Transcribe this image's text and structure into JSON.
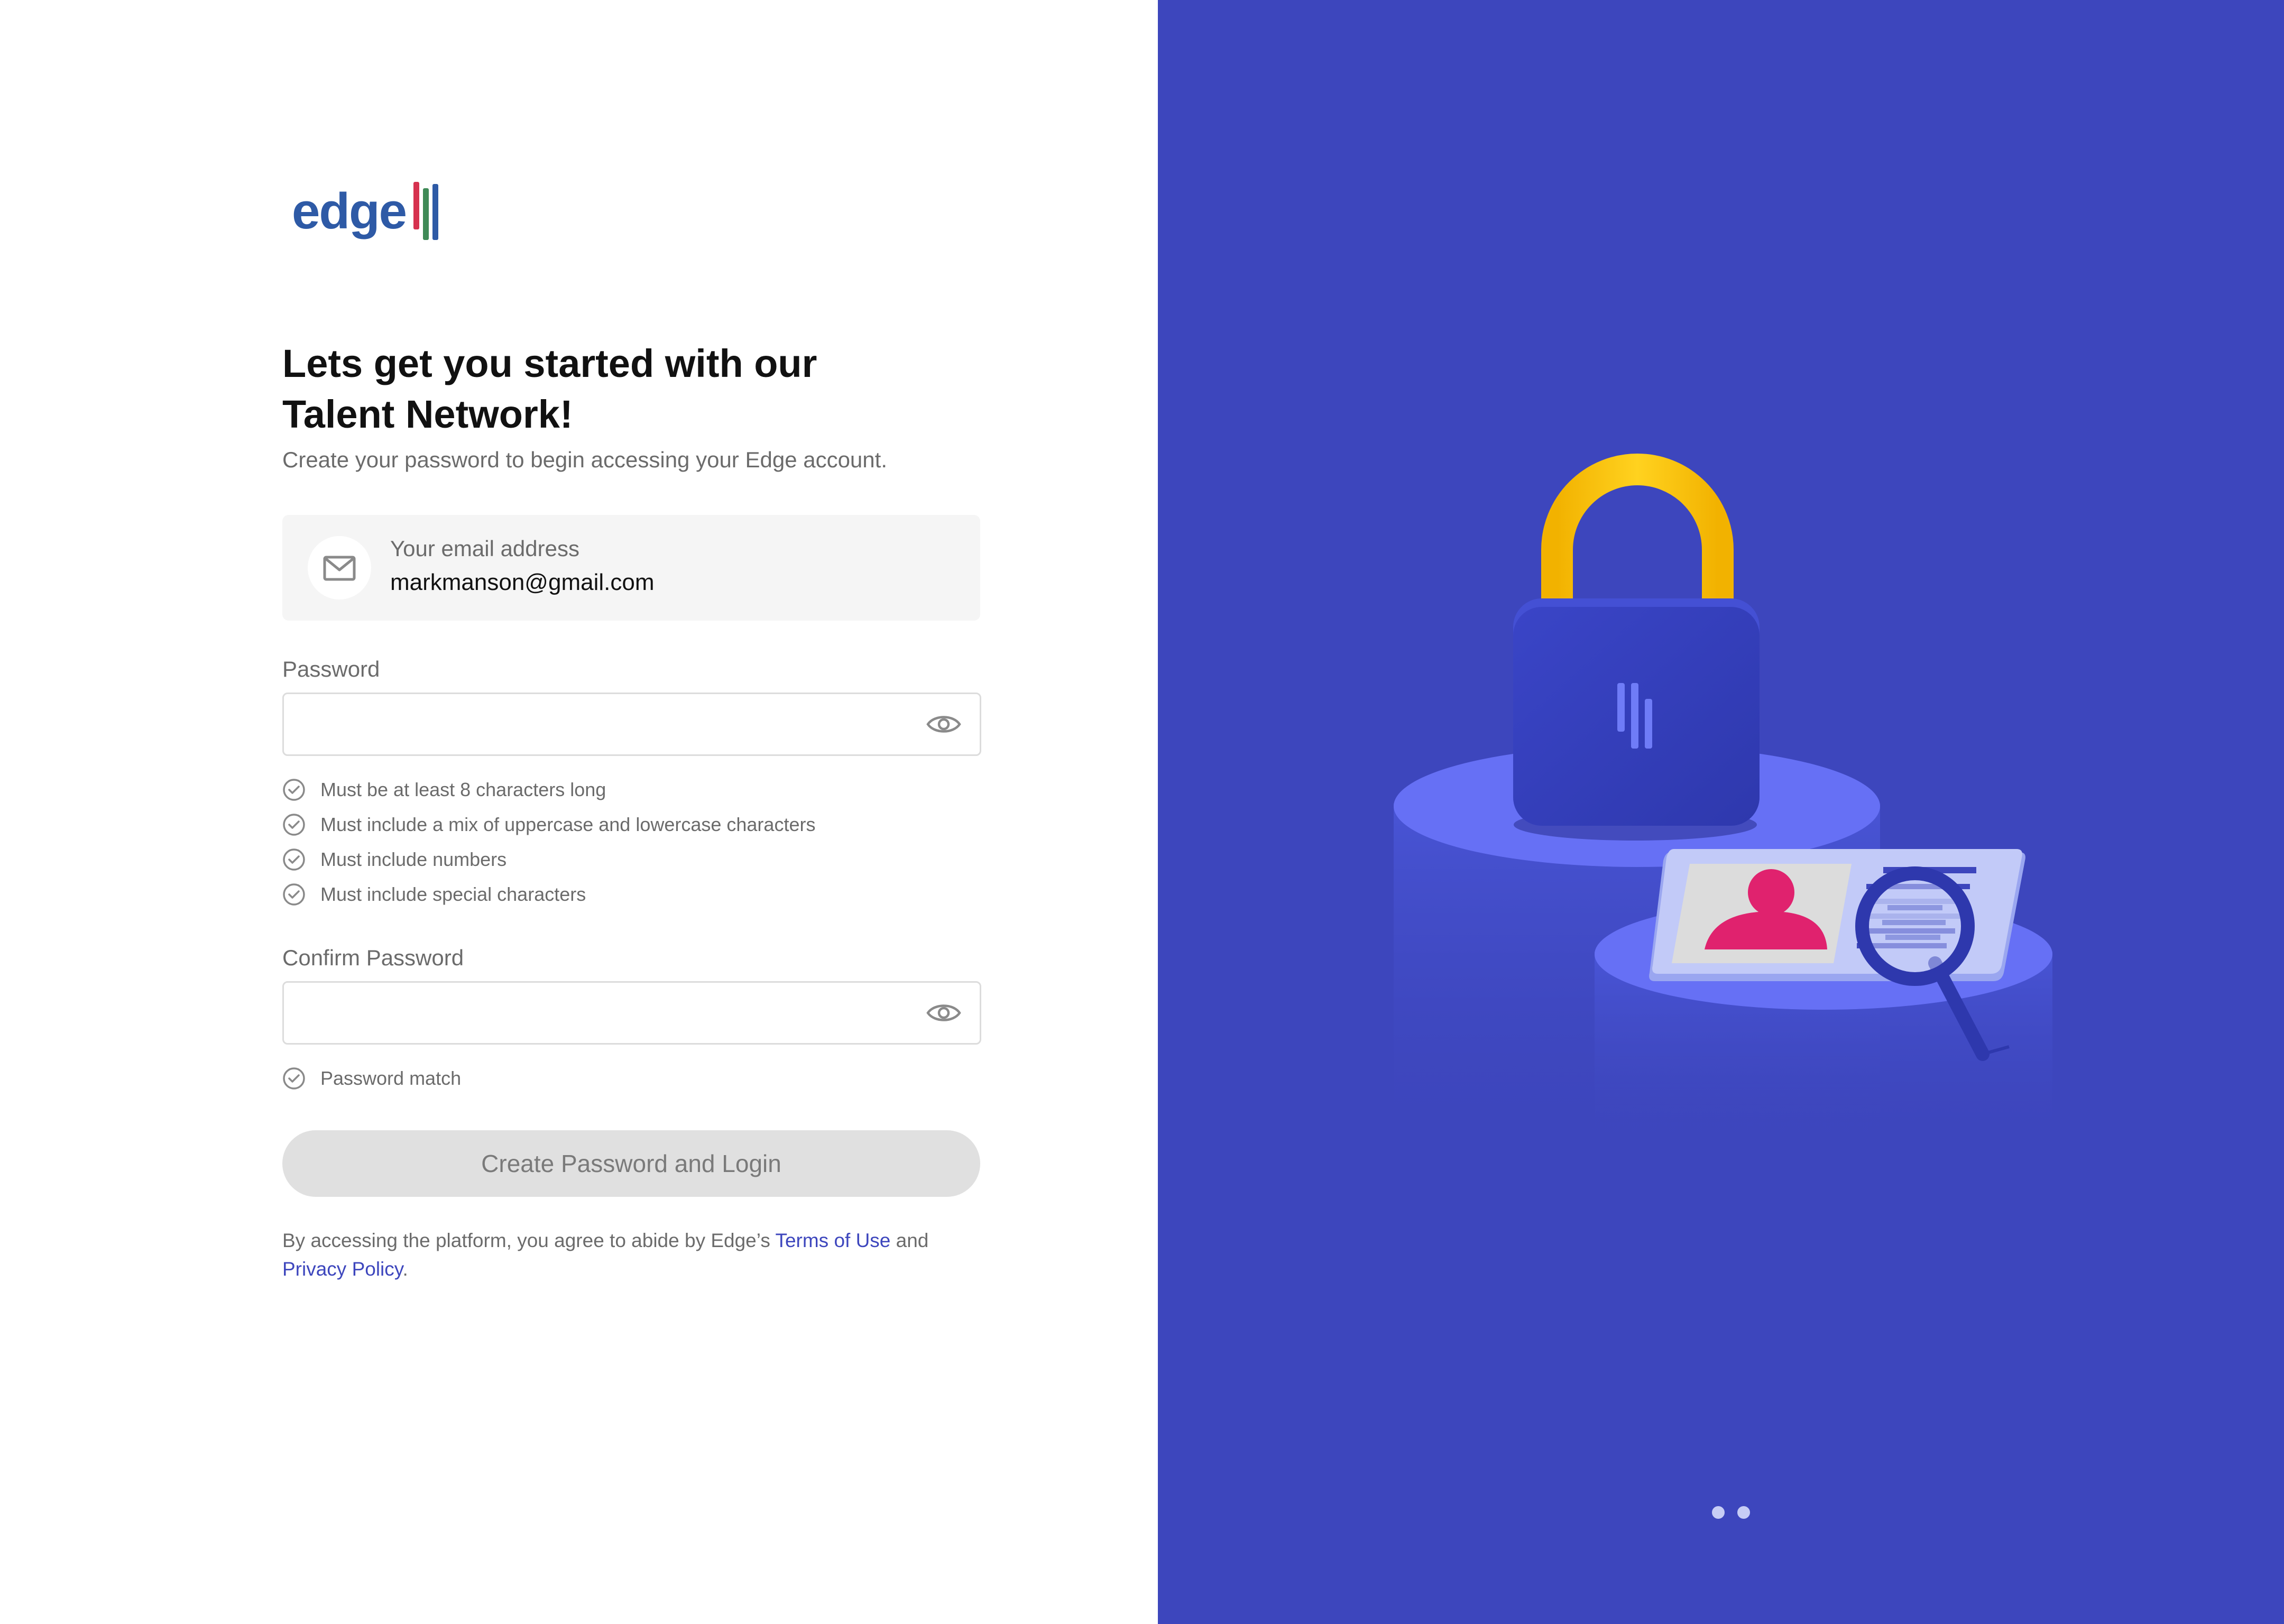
{
  "brand": {
    "name": "edge"
  },
  "heading": {
    "line1": "Lets get you started with our",
    "line2": "Talent Network!"
  },
  "subheading": "Create your password to begin accessing your Edge account.",
  "email": {
    "icon": "mail-icon",
    "label": "Your email address",
    "value": "markmanson@gmail.com"
  },
  "password": {
    "label": "Password",
    "value": "",
    "toggle_icon": "eye-icon",
    "rules": [
      "Must be at least 8 characters long",
      "Must include a mix of uppercase and lowercase characters",
      "Must include numbers",
      "Must include special characters"
    ]
  },
  "confirm": {
    "label": "Confirm Password",
    "value": "",
    "toggle_icon": "eye-icon",
    "rules": [
      "Password match"
    ]
  },
  "submit_label": "Create Password and Login",
  "legal": {
    "prefix": "By accessing the platform, you agree to abide by Edge’s ",
    "terms": "Terms of Use",
    "middle": " and",
    "privacy": "Privacy Policy",
    "suffix": "."
  },
  "carousel": {
    "slides": 2,
    "active": 1
  },
  "colors": {
    "primary": "#3d46bd",
    "brand_blue": "#2e5aa6",
    "brand_red": "#d6324f",
    "brand_green": "#3f8a57",
    "accent_yellow": "#f6c20f",
    "accent_pink": "#e0226e",
    "disabled": "#e0e0e0"
  }
}
